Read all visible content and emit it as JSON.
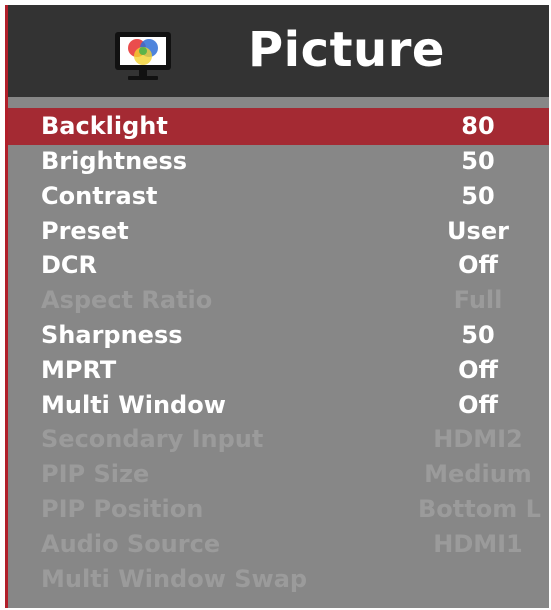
{
  "header": {
    "title": "Picture",
    "icon": "monitor-color-icon",
    "icon_colors": [
      "#e83a3a",
      "#2f6fd6",
      "#f2d22e",
      "#3fb24a"
    ]
  },
  "colors": {
    "background": "#878787",
    "header": "#333333",
    "selected": "#a42a33",
    "accent_border": "#b11f2a",
    "text": "#ffffff",
    "disabled_text": "#9b9b9b"
  },
  "menu": {
    "items": [
      {
        "label": "Backlight",
        "value": "80",
        "selected": true,
        "enabled": true
      },
      {
        "label": "Brightness",
        "value": "50",
        "selected": false,
        "enabled": true
      },
      {
        "label": "Contrast",
        "value": "50",
        "selected": false,
        "enabled": true
      },
      {
        "label": "Preset",
        "value": "User",
        "selected": false,
        "enabled": true
      },
      {
        "label": "DCR",
        "value": "Off",
        "selected": false,
        "enabled": true
      },
      {
        "label": "Aspect Ratio",
        "value": "Full",
        "selected": false,
        "enabled": false
      },
      {
        "label": "Sharpness",
        "value": "50",
        "selected": false,
        "enabled": true
      },
      {
        "label": "MPRT",
        "value": "Off",
        "selected": false,
        "enabled": true
      },
      {
        "label": "Multi Window",
        "value": "Off",
        "selected": false,
        "enabled": true
      },
      {
        "label": "Secondary Input",
        "value": "HDMI2",
        "selected": false,
        "enabled": false
      },
      {
        "label": "PIP Size",
        "value": "Medium",
        "selected": false,
        "enabled": false
      },
      {
        "label": "PIP Position",
        "value": "Bottom L",
        "selected": false,
        "enabled": false
      },
      {
        "label": "Audio Source",
        "value": "HDMI1",
        "selected": false,
        "enabled": false
      },
      {
        "label": "Multi Window Swap",
        "value": "",
        "selected": false,
        "enabled": false
      }
    ]
  }
}
